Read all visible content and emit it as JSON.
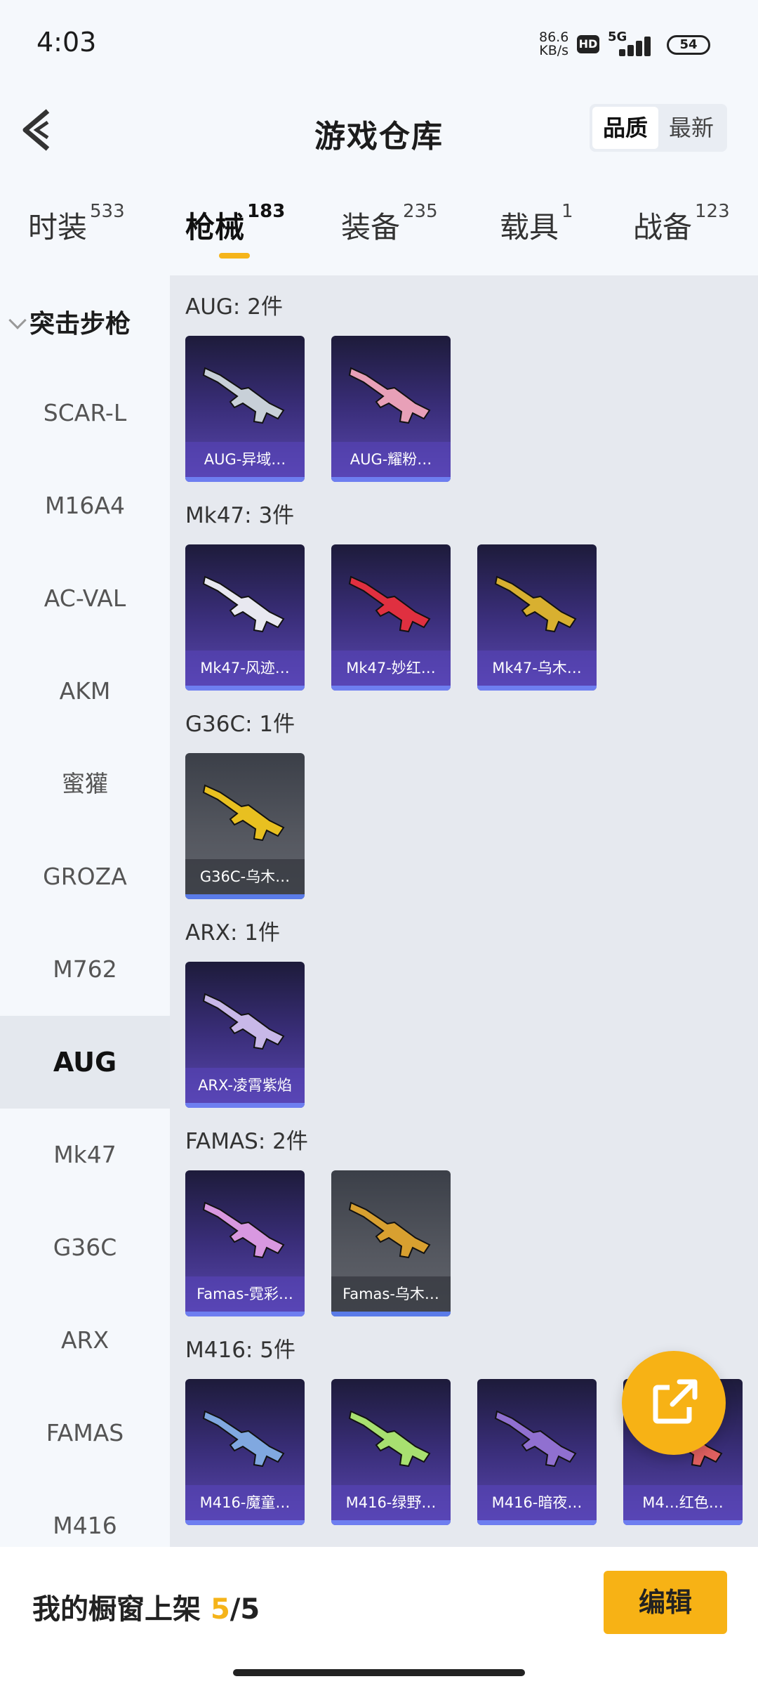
{
  "status": {
    "time": "4:03",
    "speed_value": "86.6",
    "speed_unit": "KB/s",
    "hd": "HD",
    "network": "5G",
    "battery": "54"
  },
  "header": {
    "title": "游戏仓库",
    "sort_quality": "品质",
    "sort_latest": "最新"
  },
  "tabs": [
    {
      "label": "时装",
      "count": "533"
    },
    {
      "label": "枪械",
      "count": "183"
    },
    {
      "label": "装备",
      "count": "235"
    },
    {
      "label": "载具",
      "count": "1"
    },
    {
      "label": "战备",
      "count": "123"
    }
  ],
  "sidebar": {
    "heading": "突击步枪",
    "items": [
      "SCAR-L",
      "M16A4",
      "AC-VAL",
      "AKM",
      "蜜獾",
      "GROZA",
      "M762",
      "AUG",
      "Mk47",
      "G36C",
      "ARX",
      "FAMAS",
      "M416"
    ]
  },
  "groups": [
    {
      "title": "AUG: 2件",
      "items": [
        {
          "name": "AUG-异域…",
          "grey": false,
          "color": "#c8d0d8"
        },
        {
          "name": "AUG-耀粉…",
          "grey": false,
          "color": "#e8a0b8"
        }
      ]
    },
    {
      "title": "Mk47: 3件",
      "items": [
        {
          "name": "Mk47-风迹…",
          "grey": false,
          "color": "#e8e8f0"
        },
        {
          "name": "Mk47-妙红…",
          "grey": false,
          "color": "#e03040"
        },
        {
          "name": "Mk47-乌木…",
          "grey": false,
          "color": "#d8b030"
        }
      ]
    },
    {
      "title": "G36C: 1件",
      "items": [
        {
          "name": "G36C-乌木…",
          "grey": true,
          "color": "#e8c020"
        }
      ]
    },
    {
      "title": "ARX: 1件",
      "items": [
        {
          "name": "ARX-凌霄紫焰",
          "grey": false,
          "color": "#c8b8e8"
        }
      ]
    },
    {
      "title": "FAMAS: 2件",
      "items": [
        {
          "name": "Famas-霓彩…",
          "grey": false,
          "color": "#d898e0"
        },
        {
          "name": "Famas-乌木…",
          "grey": true,
          "color": "#d8a030"
        }
      ]
    },
    {
      "title": "M416: 5件",
      "items": [
        {
          "name": "M416-魔童…",
          "grey": false,
          "color": "#80a8e0"
        },
        {
          "name": "M416-绿野…",
          "grey": false,
          "color": "#a8e070"
        },
        {
          "name": "M416-暗夜…",
          "grey": false,
          "color": "#9070d0"
        },
        {
          "name": "M4…红色…",
          "grey": false,
          "color": "#e06060"
        }
      ]
    }
  ],
  "bottom": {
    "showcase_label": "我的橱窗上架",
    "showcase_current": "5",
    "showcase_total": "/5",
    "edit_label": "编辑"
  },
  "colors": {
    "accent": "#f7b215",
    "card_purple": "#5a48b0",
    "card_grey": "#62656d"
  }
}
